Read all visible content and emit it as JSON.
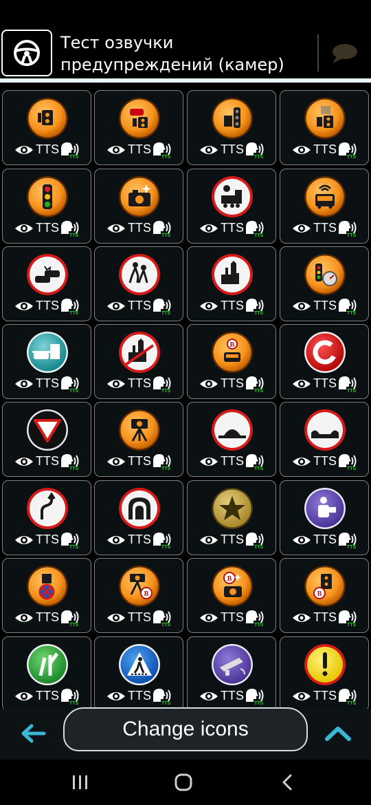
{
  "header": {
    "title": "Тест озвучки предупреждений (камер)",
    "steering_icon": "steering-wheel-icon",
    "chat_icon": "speech-bubble-icon"
  },
  "grid": {
    "eye_icon": "eye-icon",
    "speaker_icon": "speaking-head-icon",
    "tts_label": "TTS",
    "tts_small": "TTS",
    "items": [
      {
        "icon": "speed-camera-icon",
        "style": "orange"
      },
      {
        "icon": "car-camera-icon",
        "style": "orange"
      },
      {
        "icon": "traffic-light-camera-icon",
        "style": "orange"
      },
      {
        "icon": "camera-icon",
        "style": "orange"
      },
      {
        "icon": "traffic-light-icon",
        "style": "orange"
      },
      {
        "icon": "photo-camera-flash-icon",
        "style": "orange"
      },
      {
        "icon": "railway-crossing-icon",
        "style": "redring"
      },
      {
        "icon": "bus-camera-icon",
        "style": "orange"
      },
      {
        "icon": "car-accident-icon",
        "style": "redring"
      },
      {
        "icon": "children-crossing-icon",
        "style": "redring"
      },
      {
        "icon": "city-entrance-icon",
        "style": "redring"
      },
      {
        "icon": "traffic-light-speedometer-icon",
        "style": "orange"
      },
      {
        "icon": "toll-booth-icon",
        "style": "teal"
      },
      {
        "icon": "city-exit-icon",
        "style": "redring"
      },
      {
        "icon": "bus-lane-icon",
        "style": "orange"
      },
      {
        "icon": "c-sign-icon",
        "style": "red"
      },
      {
        "icon": "yield-sign-icon",
        "style": "black"
      },
      {
        "icon": "tripod-camera-icon",
        "style": "orange"
      },
      {
        "icon": "speed-bump-icon",
        "style": "redring"
      },
      {
        "icon": "road-dip-icon",
        "style": "redring"
      },
      {
        "icon": "dangerous-curve-icon",
        "style": "redring"
      },
      {
        "icon": "tunnel-icon",
        "style": "redring"
      },
      {
        "icon": "star-icon",
        "style": "gold"
      },
      {
        "icon": "police-post-icon",
        "style": "purple"
      },
      {
        "icon": "no-stopping-camera-icon",
        "style": "orange"
      },
      {
        "icon": "tripod-camera-lane-icon",
        "style": "orange"
      },
      {
        "icon": "camera-lane-flash-icon",
        "style": "orange"
      },
      {
        "icon": "camera-lane-icon",
        "style": "orange"
      },
      {
        "icon": "road-merge-icon",
        "style": "green"
      },
      {
        "icon": "pedestrian-crossing-icon",
        "style": "blue"
      },
      {
        "icon": "sensor-camera-icon",
        "style": "purple"
      },
      {
        "icon": "exclamation-icon",
        "style": "yellow"
      }
    ]
  },
  "bottom_bar": {
    "back_icon": "arrow-left-icon",
    "change_button_label": "Change icons",
    "up_icon": "chevron-up-icon"
  },
  "nav_bar": {
    "recent_icon": "recent-apps-icon",
    "home_icon": "home-icon",
    "back_icon": "back-icon"
  },
  "colors": {
    "background": "#000000",
    "cell_bg": "#0b1012",
    "cell_border": "#7d8385",
    "accent_cyan": "#3bb7d6",
    "tts_green": "#1fd31f"
  }
}
